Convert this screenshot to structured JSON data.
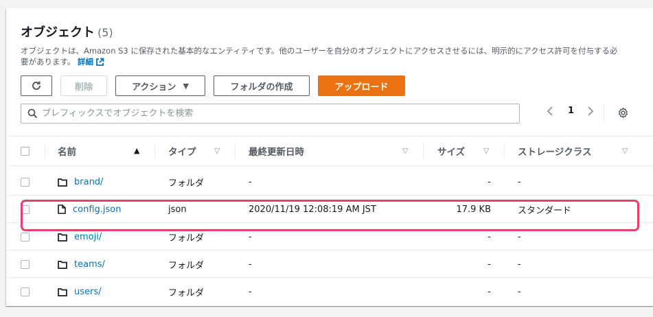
{
  "header": {
    "title": "オブジェクト",
    "count": "(5)",
    "description": "オブジェクトは、Amazon S3 に保存された基本的なエンティティです。他のユーザーを自分のオブジェクトにアクセスさせるには、明示的にアクセス許可を付与する必要があります。",
    "detail_link": "詳細"
  },
  "toolbar": {
    "delete_label": "削除",
    "actions_label": "アクション",
    "create_folder_label": "フォルダの作成",
    "upload_label": "アップロード"
  },
  "search": {
    "placeholder": "プレフィックスでオブジェクトを検索",
    "value": ""
  },
  "pagination": {
    "page": "1"
  },
  "columns": {
    "name": "名前",
    "type": "タイプ",
    "modified": "最終更新日時",
    "size": "サイズ",
    "storage": "ストレージクラス"
  },
  "rows": [
    {
      "name": "brand/",
      "type": "フォルダ",
      "modified": "-",
      "size": "-",
      "storage": "-",
      "kind": "folder-icon"
    },
    {
      "name": "config.json",
      "type": "json",
      "modified": "2020/11/19 12:08:19 AM JST",
      "size": "17.9 KB",
      "storage": "スタンダード",
      "kind": "file-icon"
    },
    {
      "name": "emoji/",
      "type": "フォルダ",
      "modified": "-",
      "size": "-",
      "storage": "-",
      "kind": "folder-icon"
    },
    {
      "name": "teams/",
      "type": "フォルダ",
      "modified": "-",
      "size": "-",
      "storage": "-",
      "kind": "folder-icon"
    },
    {
      "name": "users/",
      "type": "フォルダ",
      "modified": "-",
      "size": "-",
      "storage": "-",
      "kind": "folder-icon"
    }
  ],
  "colors": {
    "accent": "#ec7211",
    "link": "#0073bb",
    "highlight": "#ed3b6a"
  }
}
